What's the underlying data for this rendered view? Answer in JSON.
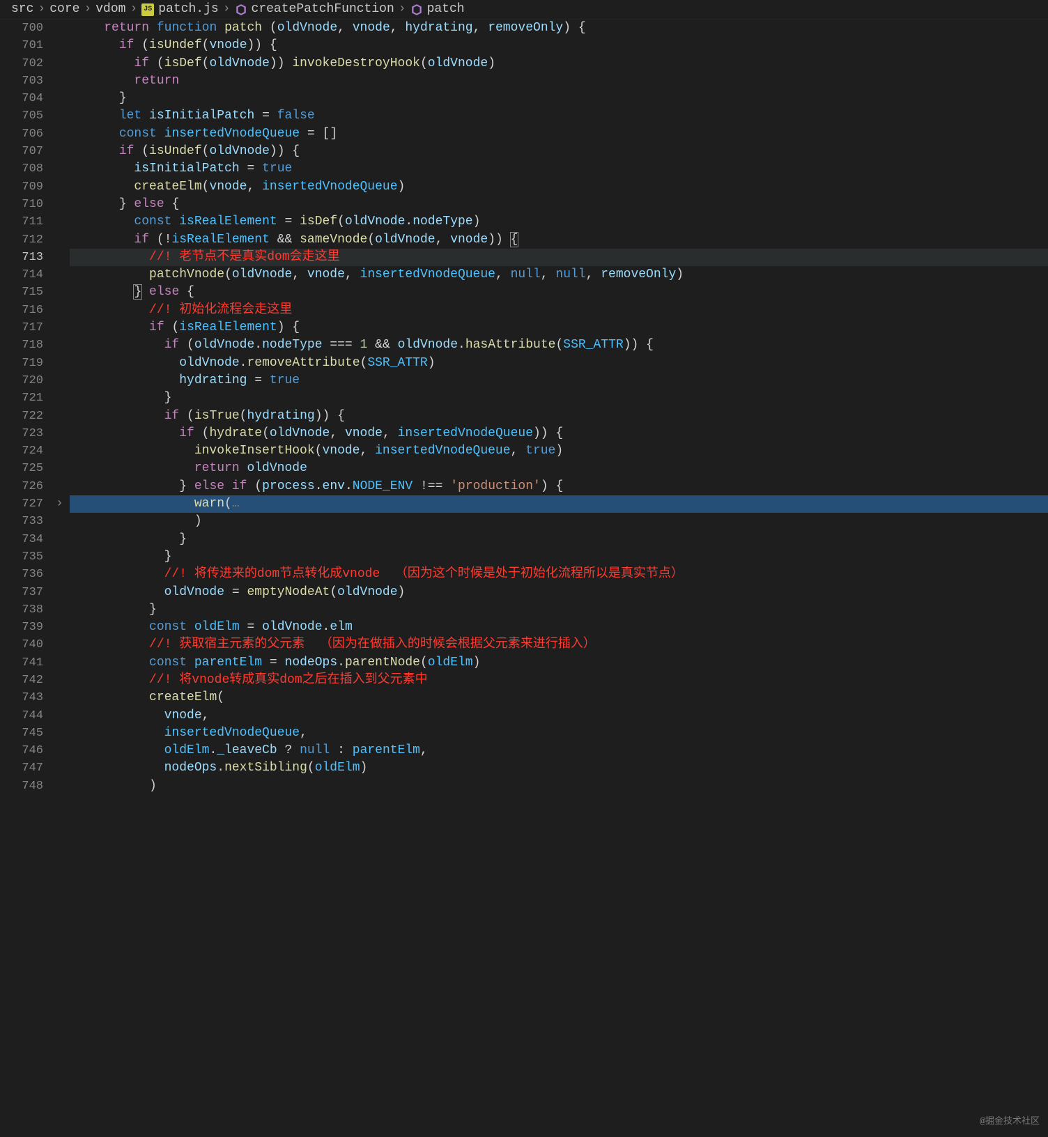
{
  "breadcrumb": {
    "seg_src": "src",
    "seg_core": "core",
    "seg_vdom": "vdom",
    "js_badge": "JS",
    "seg_file": "patch.js",
    "seg_fn1": "createPatchFunction",
    "seg_fn2": "patch"
  },
  "watermark": "@掘金技术社区",
  "gutter": {
    "lines": [
      "700",
      "701",
      "702",
      "703",
      "704",
      "705",
      "706",
      "707",
      "708",
      "709",
      "710",
      "711",
      "712",
      "713",
      "714",
      "715",
      "716",
      "717",
      "718",
      "719",
      "720",
      "721",
      "722",
      "723",
      "724",
      "725",
      "726",
      "727",
      "733",
      "734",
      "735",
      "736",
      "737",
      "738",
      "739",
      "740",
      "741",
      "742",
      "743",
      "744",
      "745",
      "746",
      "747",
      "748"
    ]
  },
  "code": {
    "l700": {
      "kw1": "return",
      "kw2": "function",
      "fn": "patch",
      "p1": "oldVnode",
      "p2": "vnode",
      "p3": "hydrating",
      "p4": "removeOnly"
    },
    "l701": {
      "kw": "if",
      "fn": "isUndef",
      "v": "vnode"
    },
    "l702": {
      "kw": "if",
      "fn1": "isDef",
      "v1": "oldVnode",
      "fn2": "invokeDestroyHook",
      "v2": "oldVnode"
    },
    "l703": {
      "kw": "return"
    },
    "l704": {},
    "l705": {
      "kw": "let",
      "v": "isInitialPatch",
      "b": "false"
    },
    "l706": {
      "kw": "const",
      "v": "insertedVnodeQueue"
    },
    "l707": {
      "kw": "if",
      "fn": "isUndef",
      "v": "oldVnode"
    },
    "l708": {
      "v": "isInitialPatch",
      "b": "true"
    },
    "l709": {
      "fn": "createElm",
      "v1": "vnode",
      "v2": "insertedVnodeQueue"
    },
    "l710": {
      "kw": "else"
    },
    "l711": {
      "kw": "const",
      "v1": "isRealElement",
      "fn": "isDef",
      "v2": "oldVnode",
      "prop": "nodeType"
    },
    "l712": {
      "kw": "if",
      "v1": "isRealElement",
      "fn": "sameVnode",
      "v2": "oldVnode",
      "v3": "vnode"
    },
    "l713": {
      "cmt": "//! 老节点不是真实dom会走这里"
    },
    "l714": {
      "fn": "patchVnode",
      "v1": "oldVnode",
      "v2": "vnode",
      "v3": "insertedVnodeQueue",
      "n1": "null",
      "n2": "null",
      "v4": "removeOnly"
    },
    "l715": {
      "kw": "else"
    },
    "l716": {
      "cmt": "//! 初始化流程会走这里"
    },
    "l717": {
      "kw": "if",
      "v": "isRealElement"
    },
    "l718": {
      "kw": "if",
      "v1": "oldVnode",
      "prop": "nodeType",
      "num": "1",
      "v2": "oldVnode",
      "fn": "hasAttribute",
      "c": "SSR_ATTR"
    },
    "l719": {
      "v": "oldVnode",
      "fn": "removeAttribute",
      "c": "SSR_ATTR"
    },
    "l720": {
      "v": "hydrating",
      "b": "true"
    },
    "l721": {},
    "l722": {
      "kw": "if",
      "fn": "isTrue",
      "v": "hydrating"
    },
    "l723": {
      "kw": "if",
      "fn": "hydrate",
      "v1": "oldVnode",
      "v2": "vnode",
      "v3": "insertedVnodeQueue"
    },
    "l724": {
      "fn": "invokeInsertHook",
      "v1": "vnode",
      "v2": "insertedVnodeQueue",
      "b": "true"
    },
    "l725": {
      "kw": "return",
      "v": "oldVnode"
    },
    "l726": {
      "kw1": "else",
      "kw2": "if",
      "v1": "process",
      "p1": "env",
      "c": "NODE_ENV",
      "str": "'production'"
    },
    "l727": {
      "fn": "warn",
      "dots": "…"
    },
    "l733": {},
    "l734": {},
    "l735": {},
    "l736": {
      "cmt": "//! 将传进来的dom节点转化成vnode  （因为这个时候是处于初始化流程所以是真实节点）"
    },
    "l737": {
      "v1": "oldVnode",
      "fn": "emptyNodeAt",
      "v2": "oldVnode"
    },
    "l738": {},
    "l739": {
      "kw": "const",
      "v1": "oldElm",
      "v2": "oldVnode",
      "prop": "elm"
    },
    "l740": {
      "cmt": "//! 获取宿主元素的父元素  （因为在做插入的时候会根据父元素来进行插入）"
    },
    "l741": {
      "kw": "const",
      "v1": "parentElm",
      "v2": "nodeOps",
      "fn": "parentNode",
      "v3": "oldElm"
    },
    "l742": {
      "cmt": "//! 将vnode转成真实dom之后在插入到父元素中"
    },
    "l743": {
      "fn": "createElm"
    },
    "l744": {
      "v": "vnode"
    },
    "l745": {
      "v": "insertedVnodeQueue"
    },
    "l746": {
      "v1": "oldElm",
      "prop": "_leaveCb",
      "n": "null",
      "v2": "parentElm"
    },
    "l747": {
      "v1": "nodeOps",
      "fn": "nextSibling",
      "v2": "oldElm"
    },
    "l748": {}
  }
}
